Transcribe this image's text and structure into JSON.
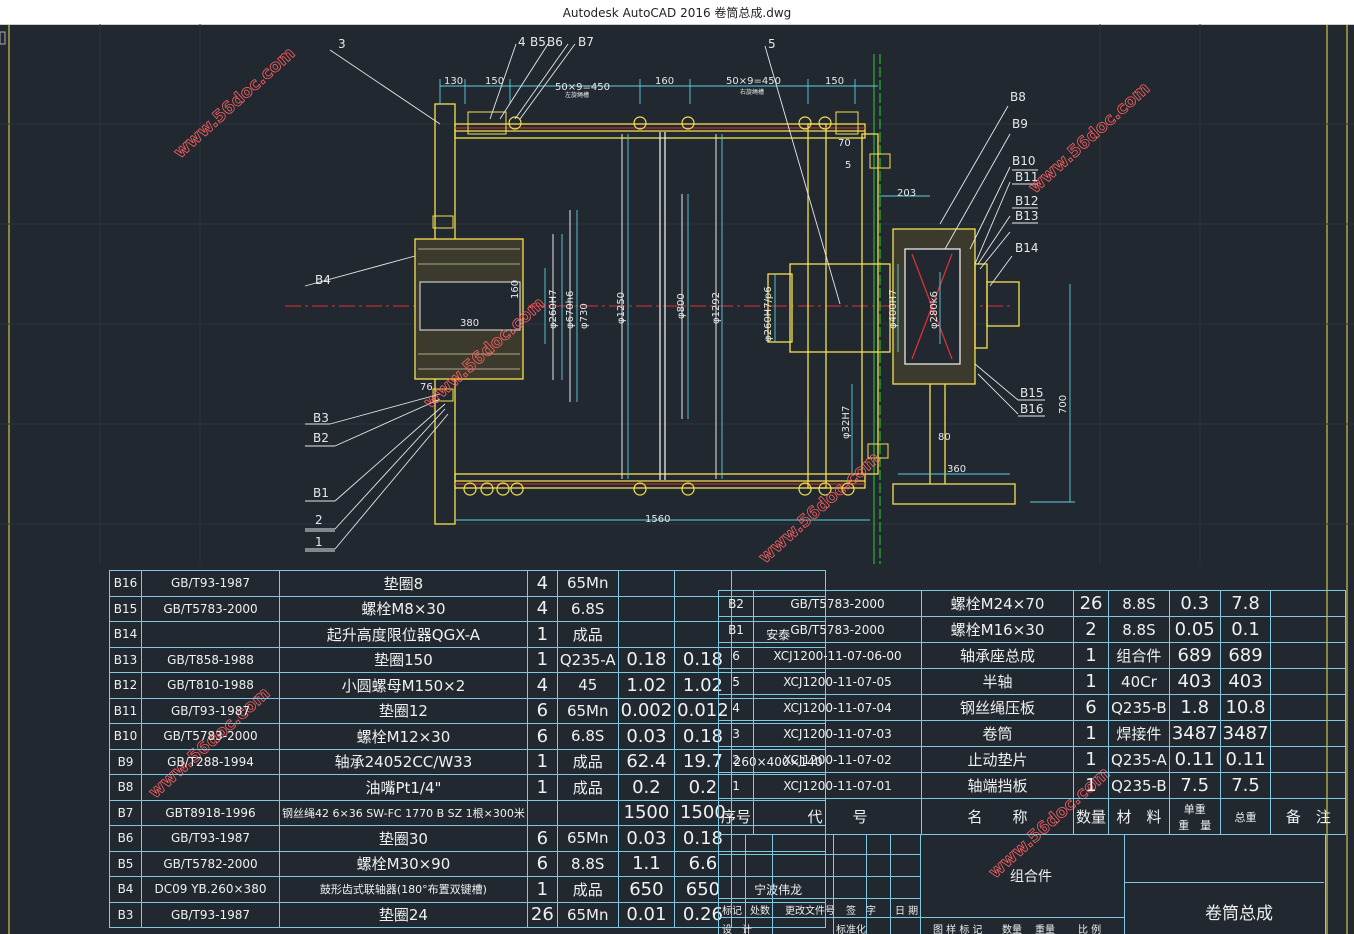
{
  "window": {
    "title": "Autodesk AutoCAD 2016     卷筒总成.dwg"
  },
  "watermark": "www.56doc.com",
  "drawing": {
    "part_labels": [
      "3",
      "4",
      "B5",
      "B6",
      "B7",
      "5",
      "B8",
      "B9",
      "B10",
      "B11",
      "B12",
      "B13",
      "B14",
      "B15",
      "B16",
      "B4",
      "B3",
      "B2",
      "B1",
      "2",
      "1"
    ],
    "dimensions": {
      "d130": "130",
      "d150a": "150",
      "d50x9a": "50×9=450",
      "d160": "160",
      "d50x9b": "50×9=450",
      "d150b": "150",
      "d70": "70",
      "d5": "5",
      "d203": "203",
      "d380": "380",
      "d76": "76",
      "d1560": "1560",
      "d360": "360",
      "d80": "80",
      "d700": "700",
      "phi260H7": "φ260H7",
      "phi670h6": "φ670h6",
      "phi730": "φ730",
      "phi1250": "φ1250",
      "phi800": "φ800",
      "phi1292": "φ1292",
      "phi260H7p6": "φ260H7/p6",
      "phi400H7": "φ400H7",
      "phi280k6": "φ280k6",
      "phi32H7": "φ32H7",
      "d160b": "160"
    },
    "notes": {
      "n1": "左旋绳槽",
      "n2": "右旋绳槽"
    }
  },
  "parts_left": [
    {
      "no": "B16",
      "code": "GB/T93-1987",
      "name": "垫圈8",
      "qty": "4",
      "mat": "65Mn",
      "unit": "",
      "total": "",
      "remark": ""
    },
    {
      "no": "B15",
      "code": "GB/T5783-2000",
      "name": "螺栓M8×30",
      "qty": "4",
      "mat": "6.8S",
      "unit": "",
      "total": "",
      "remark": ""
    },
    {
      "no": "B14",
      "code": "",
      "name": "起升高度限位器QGX-A",
      "qty": "1",
      "mat": "成品",
      "unit": "",
      "total": "",
      "remark": "安泰"
    },
    {
      "no": "B13",
      "code": "GB/T858-1988",
      "name": "垫圈150",
      "qty": "1",
      "mat": "Q235-A",
      "unit": "0.18",
      "total": "0.18",
      "remark": ""
    },
    {
      "no": "B12",
      "code": "GB/T810-1988",
      "name": "小圆螺母M150×2",
      "qty": "4",
      "mat": "45",
      "unit": "1.02",
      "total": "1.02",
      "remark": ""
    },
    {
      "no": "B11",
      "code": "GB/T93-1987",
      "name": "垫圈12",
      "qty": "6",
      "mat": "65Mn",
      "unit": "0.002",
      "total": "0.012",
      "remark": ""
    },
    {
      "no": "B10",
      "code": "GB/T5783-2000",
      "name": "螺栓M12×30",
      "qty": "6",
      "mat": "6.8S",
      "unit": "0.03",
      "total": "0.18",
      "remark": ""
    },
    {
      "no": "B9",
      "code": "GB/T288-1994",
      "name": "轴承24052CC/W33",
      "qty": "1",
      "mat": "成品",
      "unit": "62.4",
      "total": "19.7",
      "remark": "260×400×140"
    },
    {
      "no": "B8",
      "code": "",
      "name": "油嘴Pt1/4\"",
      "qty": "1",
      "mat": "成品",
      "unit": "0.2",
      "total": "0.2",
      "remark": ""
    },
    {
      "no": "B7",
      "code": "GBT8918-1996",
      "name": "钢丝绳42 6×36 SW-FC 1770 B SZ 1根×300米",
      "qty": "",
      "mat": "",
      "unit": "1500",
      "total": "1500",
      "remark": ""
    },
    {
      "no": "B6",
      "code": "GB/T93-1987",
      "name": "垫圈30",
      "qty": "6",
      "mat": "65Mn",
      "unit": "0.03",
      "total": "0.18",
      "remark": ""
    },
    {
      "no": "B5",
      "code": "GB/T5782-2000",
      "name": "螺栓M30×90",
      "qty": "6",
      "mat": "8.8S",
      "unit": "1.1",
      "total": "6.6",
      "remark": ""
    },
    {
      "no": "B4",
      "code": "DC09 YB.260×380",
      "name": "鼓形齿式联轴器(180°布置双键槽)",
      "qty": "1",
      "mat": "成品",
      "unit": "650",
      "total": "650",
      "remark": "宁波伟龙"
    },
    {
      "no": "B3",
      "code": "GB/T93-1987",
      "name": "垫圈24",
      "qty": "26",
      "mat": "65Mn",
      "unit": "0.01",
      "total": "0.26",
      "remark": ""
    }
  ],
  "parts_right": [
    {
      "no": "B2",
      "code": "GB/T5783-2000",
      "name": "螺栓M24×70",
      "qty": "26",
      "mat": "8.8S",
      "unit": "0.3",
      "total": "7.8",
      "remark": ""
    },
    {
      "no": "B1",
      "code": "GB/T5783-2000",
      "name": "螺栓M16×30",
      "qty": "2",
      "mat": "8.8S",
      "unit": "0.05",
      "total": "0.1",
      "remark": ""
    },
    {
      "no": "6",
      "code": "XCJ1200-11-07-06-00",
      "name": "轴承座总成",
      "qty": "1",
      "mat": "组合件",
      "unit": "689",
      "total": "689",
      "remark": ""
    },
    {
      "no": "5",
      "code": "XCJ1200-11-07-05",
      "name": "半轴",
      "qty": "1",
      "mat": "40Cr",
      "unit": "403",
      "total": "403",
      "remark": ""
    },
    {
      "no": "4",
      "code": "XCJ1200-11-07-04",
      "name": "钢丝绳压板",
      "qty": "6",
      "mat": "Q235-B",
      "unit": "1.8",
      "total": "10.8",
      "remark": ""
    },
    {
      "no": "3",
      "code": "XCJ1200-11-07-03",
      "name": "卷筒",
      "qty": "1",
      "mat": "焊接件",
      "unit": "3487",
      "total": "3487",
      "remark": ""
    },
    {
      "no": "2",
      "code": "XCJ1200-11-07-02",
      "name": "止动垫片",
      "qty": "1",
      "mat": "Q235-A",
      "unit": "0.11",
      "total": "0.11",
      "remark": ""
    },
    {
      "no": "1",
      "code": "XCJ1200-11-07-01",
      "name": "轴端挡板",
      "qty": "1",
      "mat": "Q235-B",
      "unit": "7.5",
      "total": "7.5",
      "remark": ""
    }
  ],
  "header_row": {
    "no": "序号",
    "code": "代　　号",
    "name": "名　　称",
    "qty": "数量",
    "mat": "材　料",
    "unit": "单重",
    "total": "总重",
    "weight": "重　量",
    "remark": "备　注"
  },
  "title_block": {
    "assembly": "组合件",
    "drawing_name": "卷筒总成",
    "sign_labels": [
      "标记",
      "处数",
      "更改文件号",
      "签　字",
      "日 期"
    ],
    "bottom_labels": [
      "设　计",
      "标准化",
      "图 样 标 记",
      "数量",
      "重量",
      "比 例"
    ]
  }
}
